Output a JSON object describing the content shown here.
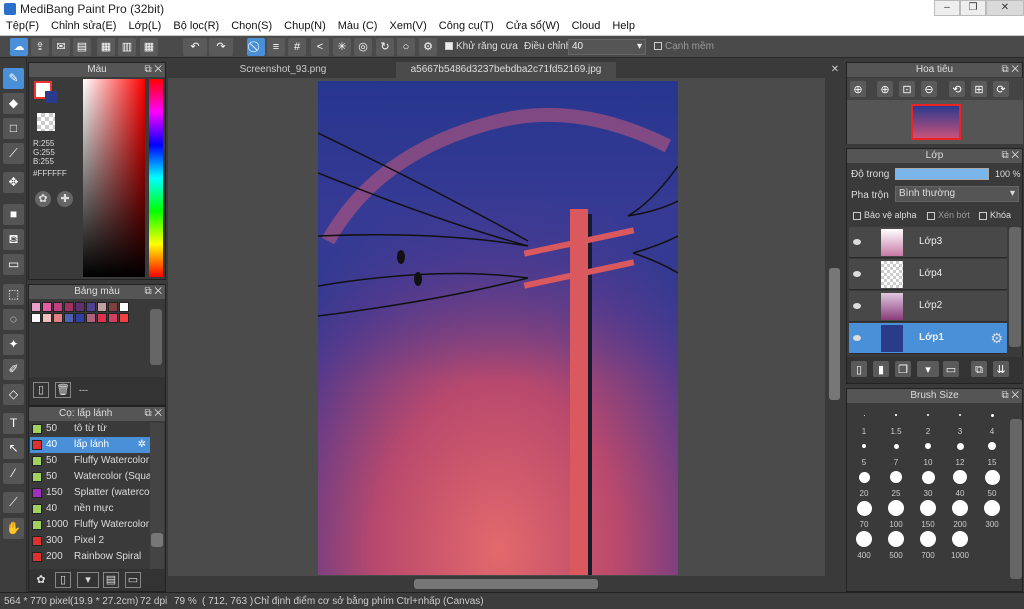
{
  "window": {
    "title": "MediBang Paint Pro (32bit)"
  },
  "menu": [
    "Tệp(F)",
    "Chỉnh sửa(E)",
    "Lớp(L)",
    "Bộ lọc(R)",
    "Chọn(S)",
    "Chụp(N)",
    "Màu (C)",
    "Xem(V)",
    "Công cụ(T)",
    "Cửa sổ(W)",
    "Cloud",
    "Help"
  ],
  "toolbar": {
    "antialias_label": "Khử răng cưa",
    "adjust_label": "Điều chỉnh",
    "adjust_value": "40",
    "smooth_label": "Cạnh mềm"
  },
  "color_panel": {
    "title": "Màu",
    "rgb": "R:255\nG:255\nB:255",
    "hex": "#FFFFFF",
    "accent": "#4a90d9"
  },
  "palette_panel": {
    "title": "Bảng màu",
    "swatches": [
      "#e8a0c8",
      "#e060a0",
      "#c04080",
      "#a03060",
      "#603070",
      "#504090",
      "#c0a0a0",
      "#804040",
      "#ffffff",
      "#f8f8f8",
      "#f0c0c0",
      "#e08080",
      "#5060b0",
      "#3040a0",
      "#b06080",
      "#e03050",
      "#d04060",
      "#f04040"
    ],
    "footer": "---"
  },
  "brush_panel": {
    "title": "Cọ: lấp lánh",
    "items": [
      {
        "num": "50",
        "name": "tô từ từ",
        "color": "#a0d060"
      },
      {
        "num": "40",
        "name": "lấp lánh",
        "color": "#e03030",
        "selected": true
      },
      {
        "num": "50",
        "name": "Fluffy Watercolor",
        "color": "#a0d060"
      },
      {
        "num": "50",
        "name": "Watercolor (Squa",
        "color": "#a0d060"
      },
      {
        "num": "150",
        "name": "Splatter (waterco",
        "color": "#a030c0"
      },
      {
        "num": "40",
        "name": "nền mực",
        "color": "#a0d060"
      },
      {
        "num": "1000",
        "name": "Fluffy Watercolor",
        "color": "#a0d060"
      },
      {
        "num": "300",
        "name": "Pixel 2",
        "color": "#e03030"
      },
      {
        "num": "200",
        "name": "Rainbow Spiral",
        "color": "#e03030"
      }
    ]
  },
  "tabs": [
    {
      "label": "Screenshot_93.png"
    },
    {
      "label": "a5667b5486d3237bebdba2c71fd52169.jpg"
    }
  ],
  "navigator": {
    "title": "Hoa tiêu"
  },
  "layer_panel": {
    "title": "Lớp",
    "opacity_label": "Độ trong",
    "opacity_value": "100 %",
    "blend_label": "Pha trộn",
    "blend_value": "Bình thường",
    "alpha_label": "Bảo vệ alpha",
    "clip_label": "Xén bớt",
    "lock_label": "Khóa",
    "layers": [
      {
        "name": "Lớp3"
      },
      {
        "name": "Lớp4"
      },
      {
        "name": "Lớp2"
      },
      {
        "name": "Lớp1",
        "selected": true
      }
    ]
  },
  "size_panel": {
    "title": "Brush Size",
    "sizes": [
      "1",
      "1.5",
      "2",
      "3",
      "4",
      "5",
      "7",
      "10",
      "12",
      "15",
      "20",
      "25",
      "30",
      "40",
      "50",
      "70",
      "100",
      "150",
      "200",
      "300",
      "400",
      "500",
      "700",
      "1000"
    ]
  },
  "status": {
    "dims": "564 * 770 pixel",
    "cm": "(19.9 * 27.2cm)",
    "dpi": "72 dpi",
    "zoom": "79 %",
    "coords": "( 712, 763 )",
    "hint": "Chỉ định điểm cơ sở bằng phím Ctrl+nhấp (Canvas)"
  }
}
